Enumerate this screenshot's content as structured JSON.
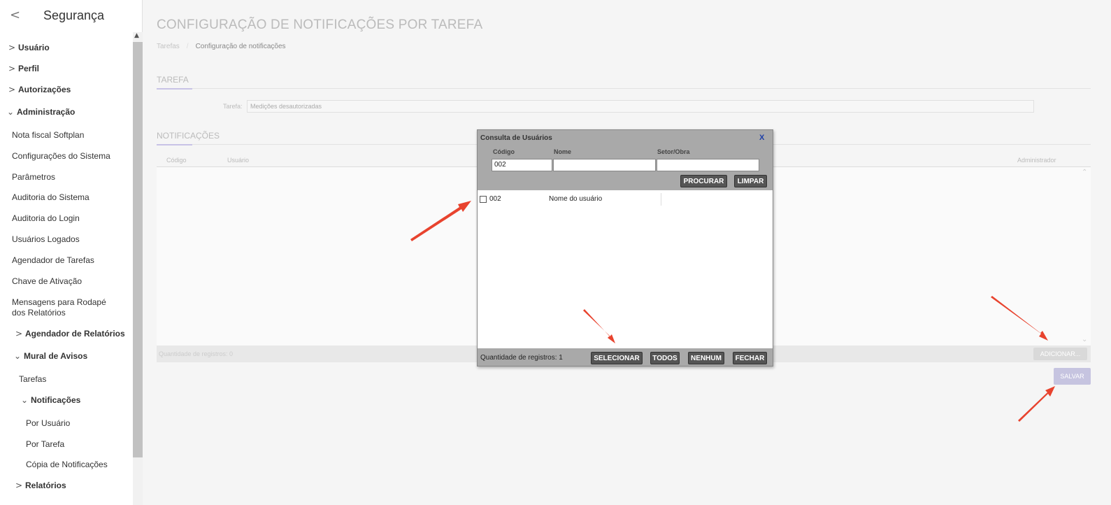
{
  "sidebar": {
    "title": "Segurança",
    "items": [
      {
        "label": "Usuário"
      },
      {
        "label": "Perfil"
      },
      {
        "label": "Autorizações"
      },
      {
        "label": "Administração"
      },
      {
        "label": "Nota fiscal Softplan"
      },
      {
        "label": "Configurações do Sistema"
      },
      {
        "label": "Parâmetros"
      },
      {
        "label": "Auditoria do Sistema"
      },
      {
        "label": "Auditoria do Login"
      },
      {
        "label": "Usuários Logados"
      },
      {
        "label": "Agendador de Tarefas"
      },
      {
        "label": "Chave de Ativação"
      },
      {
        "label": "Mensagens para Rodapé"
      },
      {
        "label": "dos Relatórios"
      },
      {
        "label": "Agendador de Relatórios"
      },
      {
        "label": "Mural de Avisos"
      },
      {
        "label": "Tarefas"
      },
      {
        "label": "Notificações"
      },
      {
        "label": "Por Usuário"
      },
      {
        "label": "Por Tarefa"
      },
      {
        "label": "Cópia de Notificações"
      },
      {
        "label": "Relatórios"
      }
    ]
  },
  "page": {
    "title": "CONFIGURAÇÃO DE NOTIFICAÇÕES POR TAREFA",
    "breadcrumb": [
      "Tarefas",
      "Configuração de notificações"
    ],
    "tarefa_section": "TAREFA",
    "tarefa_label": "Tarefa:",
    "tarefa_value": "Medições desautorizadas",
    "notificacoes_section": "NOTIFICAÇÕES",
    "columns": {
      "codigo": "Código",
      "usuario": "Usuário",
      "administrador": "Administrador"
    },
    "records_count": "Quantidade de registros: 0",
    "add_button": "ADICIONAR...",
    "save_button": "SALVAR"
  },
  "modal": {
    "title": "Consulta de Usuários",
    "close": "X",
    "fields": {
      "codigo_label": "Código",
      "codigo_value": "002",
      "nome_label": "Nome",
      "nome_value": "",
      "setor_label": "Setor/Obra",
      "setor_value": ""
    },
    "procurar": "PROCURAR",
    "limpar": "LIMPAR",
    "row": {
      "code": "002",
      "name": "Nome do usuário"
    },
    "records_count": "Quantidade de registros: 1",
    "selecionar": "SELECIONAR",
    "todos": "TODOS",
    "nenhum": "NENHUM",
    "fechar": "FECHAR"
  },
  "colors": {
    "arrow": "#e8432e",
    "accent": "#c8c3e6"
  }
}
